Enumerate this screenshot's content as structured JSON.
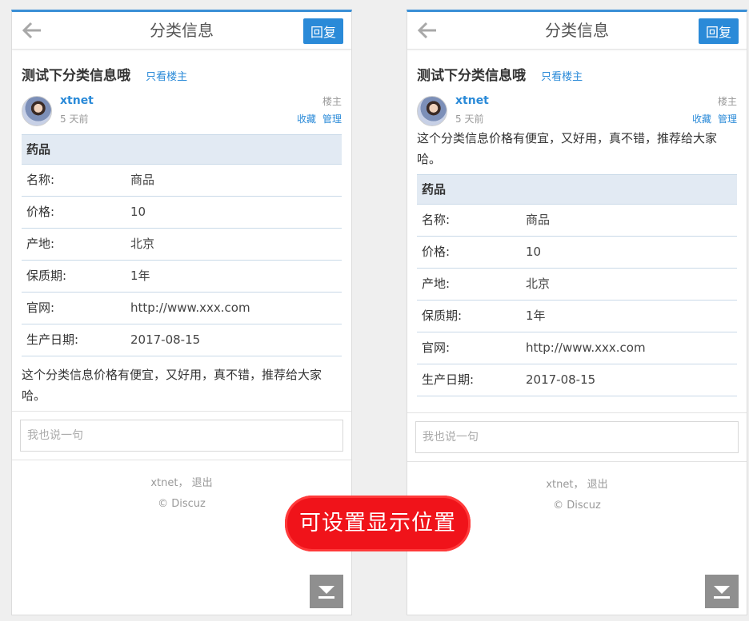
{
  "colors": {
    "accent": "#2a8ad8",
    "table_header_bg": "#e2eaf3",
    "callout": "#f0131a"
  },
  "header": {
    "title": "分类信息",
    "reply_label": "回复"
  },
  "thread": {
    "title": "测试下分类信息哦",
    "only_op_label": "只看楼主"
  },
  "post": {
    "author": "xtnet",
    "time": "5 天前",
    "floor": "楼主",
    "favorite_label": "收藏",
    "manage_label": "管理",
    "text": "这个分类信息价格有便宜，又好用，真不错，推荐给大家哈。"
  },
  "info": {
    "header": "药品",
    "rows": [
      {
        "label": "名称:",
        "value": "商品"
      },
      {
        "label": "价格:",
        "value": "10"
      },
      {
        "label": "产地:",
        "value": "北京"
      },
      {
        "label": "保质期:",
        "value": "1年"
      },
      {
        "label": "官网:",
        "value": "http://www.xxx.com"
      },
      {
        "label": "生产日期:",
        "value": "2017-08-15"
      }
    ]
  },
  "reply": {
    "placeholder": "我也说一句"
  },
  "footer": {
    "user": "xtnet",
    "separator": "，",
    "logout": "退出",
    "copyright": "© Discuz"
  },
  "callout": {
    "text": "可设置显示位置"
  },
  "icons": {
    "back": "arrow-left-icon",
    "scroll": "scroll-to-bottom-icon"
  }
}
